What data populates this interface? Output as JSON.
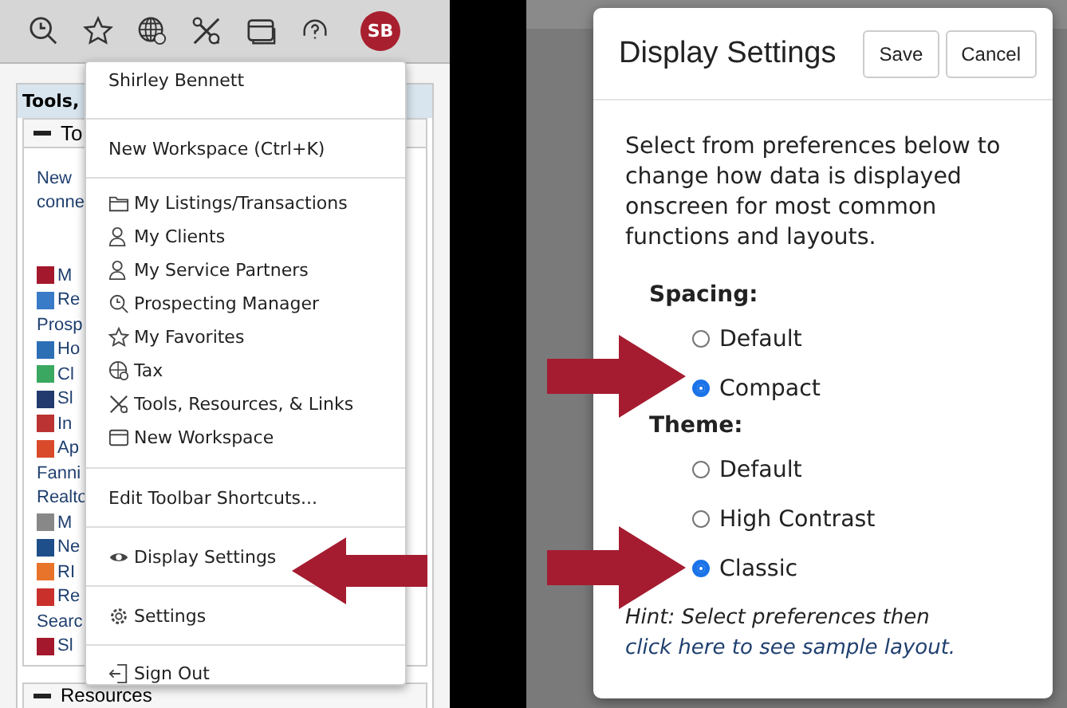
{
  "left_screen": {
    "toolbar": {
      "avatar_initials": "SB"
    },
    "background": {
      "panel_title": "Tools,",
      "section_title": "To",
      "intro_lines": [
        "New",
        "conne"
      ],
      "links": [
        {
          "text": "M",
          "kind": "app"
        },
        {
          "text": "Re",
          "kind": "app"
        },
        {
          "text": "Prosp",
          "kind": "text"
        },
        {
          "text": "Ho",
          "kind": "app"
        },
        {
          "text": "Cl",
          "kind": "app"
        },
        {
          "text": "Sl",
          "kind": "app"
        },
        {
          "text": "In",
          "kind": "app"
        },
        {
          "text": "Ap",
          "kind": "app"
        },
        {
          "text": "Fanni",
          "kind": "text"
        },
        {
          "text": "Realto",
          "kind": "text"
        },
        {
          "text": "M",
          "kind": "app"
        },
        {
          "text": "Ne",
          "kind": "app"
        },
        {
          "text": "RI",
          "kind": "app"
        },
        {
          "text": "Re",
          "kind": "app"
        },
        {
          "text": "Searc",
          "kind": "text"
        },
        {
          "text": "Sl",
          "kind": "app"
        }
      ],
      "footer_section": "Resources"
    },
    "user_menu": {
      "sections": [
        [
          "Shirley Bennett"
        ],
        [
          "New Workspace (Ctrl+K)"
        ],
        [
          "My Listings/Transactions",
          "My Clients",
          "My Service Partners",
          "Prospecting Manager",
          "My Favorites",
          "Tax",
          "Tools, Resources, & Links",
          "New Workspace"
        ],
        [
          "Edit Toolbar Shortcuts..."
        ],
        [
          "Display Settings"
        ],
        [
          "Settings"
        ],
        [
          "Sign Out"
        ]
      ]
    }
  },
  "right_screen": {
    "dialog": {
      "title": "Display Settings",
      "buttons": [
        "Save",
        "Cancel"
      ],
      "description": "Select from preferences below to change how data is displayed onscreen for most common functions and layouts.",
      "groups": [
        {
          "heading": "Spacing:",
          "options": [
            {
              "label": "Default",
              "selected": false
            },
            {
              "label": "Compact",
              "selected": true
            }
          ]
        },
        {
          "heading": "Theme:",
          "options": [
            {
              "label": "Default",
              "selected": false
            },
            {
              "label": "High Contrast",
              "selected": false
            },
            {
              "label": "Classic",
              "selected": true
            }
          ]
        }
      ],
      "hint": {
        "text": "Hint: Select preferences then",
        "link": "click here to see sample layout."
      }
    }
  }
}
